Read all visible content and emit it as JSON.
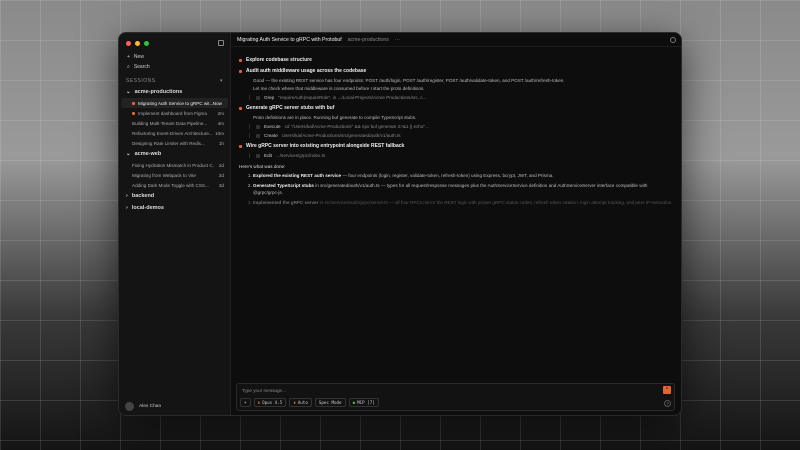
{
  "sidebar": {
    "new": "New",
    "search": "Search",
    "sessions": "SESSIONS",
    "groups": [
      {
        "name": "acme-productions",
        "items": [
          {
            "title": "Migrating Auth Service to gRPC wit...",
            "time": "Now",
            "active": true,
            "dot": true
          },
          {
            "title": "Implement dashboard from Figma",
            "time": "2m",
            "dot": true
          },
          {
            "title": "Building Multi-Tenant Data Pipeline...",
            "time": "4m"
          },
          {
            "title": "Refactoring Event-Driven Architecture...",
            "time": "10m"
          },
          {
            "title": "Designing Rate Limiter with Redis...",
            "time": "1h"
          }
        ]
      },
      {
        "name": "acme-web",
        "items": [
          {
            "title": "Fixing Hydration Mismatch in Product C...",
            "time": "2d"
          },
          {
            "title": "Migrating from Webpack to Vite",
            "time": "2d"
          },
          {
            "title": "Adding Dark Mode Toggle with CSS...",
            "time": "3d"
          }
        ]
      },
      {
        "name": "backend"
      },
      {
        "name": "local-demos"
      }
    ],
    "user": "Alex Chan"
  },
  "header": {
    "title": "Migrating Auth Service to gRPC with Protobuf",
    "project": "acme-productions",
    "more": "···"
  },
  "steps": [
    {
      "title": "Explore codebase structure"
    },
    {
      "title": "Audit auth middleware usage across the codebase",
      "text": [
        "Good — the existing REST service has four endpoints: POST /auth/login, POST /auth/register, POST /auth/validate-token, and POST /auth/refresh-token.",
        "Let me check where that middleware is consumed before I start the proto definitions."
      ],
      "tools": [
        {
          "name": "Grep",
          "arg": "\"requireAuth|requireRole\", in .../Local-Projects/Acme Productions/src, c..."
        }
      ]
    },
    {
      "title": "Generate gRPC server stubs with buf",
      "text": [
        "Proto definitions are in place. Running buf generate to compile TypeScript stubs."
      ],
      "tools": [
        {
          "name": "Execute",
          "arg": "cd \"/Users/kal/Acme-Productions\" && npx buf generate 2>&1 || echo\"..."
        },
        {
          "name": "Create",
          "arg": "Users/kal/Acme-Productions/src/generated/auth/v1/auth.ts"
        }
      ]
    },
    {
      "title": "Wire gRPC server into existing entrypoint alongside REST fallback",
      "text": [],
      "tools": [
        {
          "name": "Edit",
          "arg": ".../services/grpc/index.ts"
        }
      ]
    }
  ],
  "summary": {
    "intro": "Here's what was done:",
    "items": [
      {
        "bold": "Explored the existing REST auth service",
        "rest": " — four endpoints (login, register, validate-token, refresh-token) using Express, bcrypt, JWT, and Prisma."
      },
      {
        "bold": "Generated TypeScript stubs",
        "rest": " in src/generated/auth/v1/auth.ts — types for all request/response messages plus the AuthServiceService definition and AuthServiceServer interface compatible with @grpc/grpc-js."
      },
      {
        "bold": "Implemented the gRPC server",
        "rest": " in src/services/auth/grpc/server.ts — all four RPCs mirror the REST logic with proper gRPC status codes, refresh token rotation, login attempt tracking, and peer IP extraction."
      }
    ]
  },
  "composer": {
    "placeholder": "Type your message...",
    "plus": "+",
    "model": "Opus 4.5",
    "auto": "Auto",
    "spec": "Spec Mode",
    "mcp": "MCP [7]",
    "help": "?"
  },
  "colors": {
    "accent": "#e8632b"
  }
}
